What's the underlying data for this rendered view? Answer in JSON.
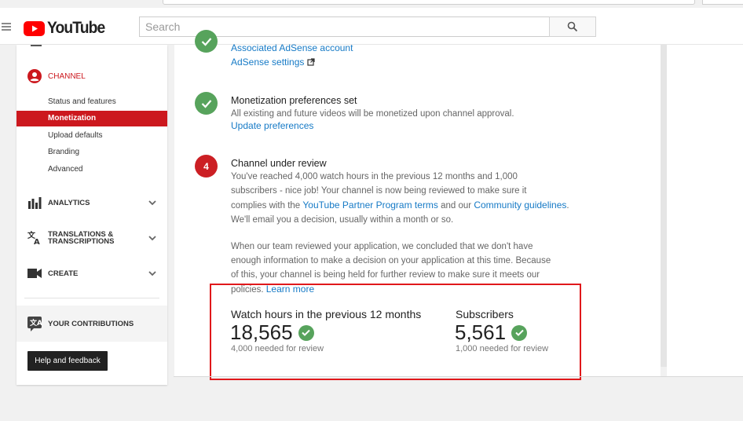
{
  "header": {
    "logo_text": "YouTube",
    "search_placeholder": "Search"
  },
  "sidebar": {
    "channel_label": "CHANNEL",
    "channel_items": [
      {
        "label": "Status and features",
        "active": false
      },
      {
        "label": "Monetization",
        "active": true
      },
      {
        "label": "Upload defaults",
        "active": false
      },
      {
        "label": "Branding",
        "active": false
      },
      {
        "label": "Advanced",
        "active": false
      }
    ],
    "sections": [
      {
        "label": "ANALYTICS",
        "icon": "analytics-icon"
      },
      {
        "label": "TRANSLATIONS & TRANSCRIPTIONS",
        "icon": "translate-icon"
      },
      {
        "label": "CREATE",
        "icon": "video-camera-icon"
      }
    ],
    "contributions_label": "YOUR CONTRIBUTIONS",
    "help_label": "Help and feedback"
  },
  "steps": {
    "adsense": {
      "link1": "Associated AdSense account",
      "link2": "AdSense settings"
    },
    "preferences": {
      "title": "Monetization preferences set",
      "text": "All existing and future videos will be monetized upon channel approval.",
      "link": "Update preferences"
    },
    "review": {
      "number": "4",
      "title": "Channel under review",
      "text_line1": "You've reached 4,000 watch hours in the previous 12 months and 1,000",
      "text_line2": "subscribers - nice job! Your channel is now being reviewed to make sure it",
      "text_line3_pre": "complies with the ",
      "text_line3_link1": "YouTube Partner Program terms",
      "text_line3_mid": " and our ",
      "text_line3_link2": "Community guidelines",
      "text_line3_post": ".",
      "text_line4": "We'll email you a decision, usually within a month or so.",
      "para2_line1": "When our team reviewed your application, we concluded that we don't have",
      "para2_line2": "enough information to make a decision on your application at this time. Because",
      "para2_line3": "of this, your channel is being held for further review to make sure it meets our",
      "para2_line4_pre": "policies. ",
      "para2_link": "Learn more"
    }
  },
  "stats": {
    "watch": {
      "label": "Watch hours in the previous 12 months",
      "value": "18,565",
      "note": "4,000 needed for review"
    },
    "subs": {
      "label": "Subscribers",
      "value": "5,561",
      "note": "1,000 needed for review"
    }
  },
  "colors": {
    "accent_red": "#cc181e",
    "link_blue": "#167ac6",
    "check_green": "#57a35c",
    "highlight_border": "#e0181b"
  }
}
